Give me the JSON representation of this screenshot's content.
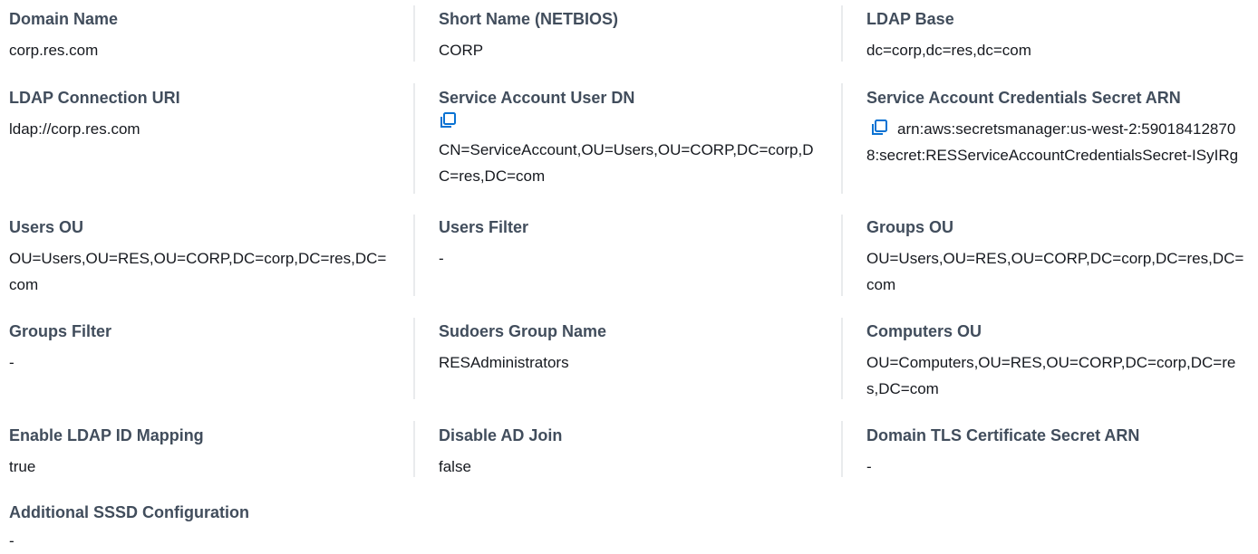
{
  "fields": {
    "domain_name": {
      "label": "Domain Name",
      "value": "corp.res.com"
    },
    "short_name": {
      "label": "Short Name (NETBIOS)",
      "value": "CORP"
    },
    "ldap_base": {
      "label": "LDAP Base",
      "value": "dc=corp,dc=res,dc=com"
    },
    "ldap_connection_uri": {
      "label": "LDAP Connection URI",
      "value": "ldap://corp.res.com"
    },
    "service_account_user_dn": {
      "label": "Service Account User DN",
      "value": "CN=ServiceAccount,OU=Users,OU=CORP,DC=corp,DC=res,DC=com"
    },
    "service_account_secret_arn": {
      "label": "Service Account Credentials Secret ARN",
      "value": "arn:aws:secretsmanager:us-west-2:590184128708:secret:RESServiceAccountCredentialsSecret-ISyIRg"
    },
    "users_ou": {
      "label": "Users OU",
      "value": "OU=Users,OU=RES,OU=CORP,DC=corp,DC=res,DC=com"
    },
    "users_filter": {
      "label": "Users Filter",
      "value": "-"
    },
    "groups_ou": {
      "label": "Groups OU",
      "value": "OU=Users,OU=RES,OU=CORP,DC=corp,DC=res,DC=com"
    },
    "groups_filter": {
      "label": "Groups Filter",
      "value": "-"
    },
    "sudoers_group_name": {
      "label": "Sudoers Group Name",
      "value": "RESAdministrators"
    },
    "computers_ou": {
      "label": "Computers OU",
      "value": "OU=Computers,OU=RES,OU=CORP,DC=corp,DC=res,DC=com"
    },
    "enable_ldap_id_mapping": {
      "label": "Enable LDAP ID Mapping",
      "value": "true"
    },
    "disable_ad_join": {
      "label": "Disable AD Join",
      "value": "false"
    },
    "domain_tls_secret_arn": {
      "label": "Domain TLS Certificate Secret ARN",
      "value": "-"
    },
    "additional_sssd_config": {
      "label": "Additional SSSD Configuration",
      "value": "-"
    }
  },
  "icons": {
    "copy": "copy-icon"
  },
  "colors": {
    "label": "#414d5c",
    "value": "#16191f",
    "divider": "#e9ebed",
    "copy_icon": "#0972d3"
  }
}
